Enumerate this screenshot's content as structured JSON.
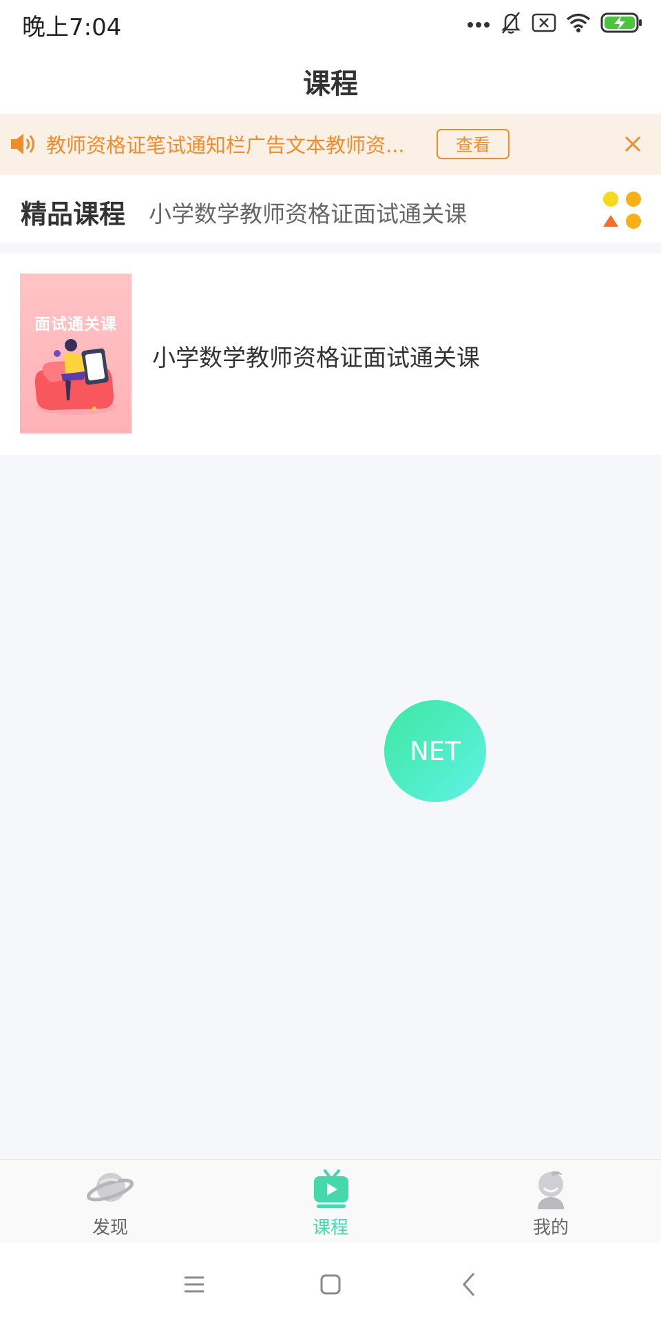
{
  "status_bar": {
    "time": "晚上7:04"
  },
  "header": {
    "title": "课程"
  },
  "notice": {
    "text": "教师资格证笔试通知栏广告文本教师资...",
    "view_button": "查看"
  },
  "featured": {
    "label": "精品课程",
    "title": "小学数学教师资格证面试通关课"
  },
  "course": {
    "cover_text": "面试通关课",
    "name": "小学数学教师资格证面试通关课"
  },
  "fab": {
    "label": "NET"
  },
  "tabs": [
    {
      "label": "发现",
      "icon": "planet-icon"
    },
    {
      "label": "课程",
      "icon": "tv-play-icon"
    },
    {
      "label": "我的",
      "icon": "user-icon"
    }
  ],
  "colors": {
    "accent": "#45d8aa",
    "notice": "#f08c2a",
    "notice_bg": "#fbf0e6"
  }
}
